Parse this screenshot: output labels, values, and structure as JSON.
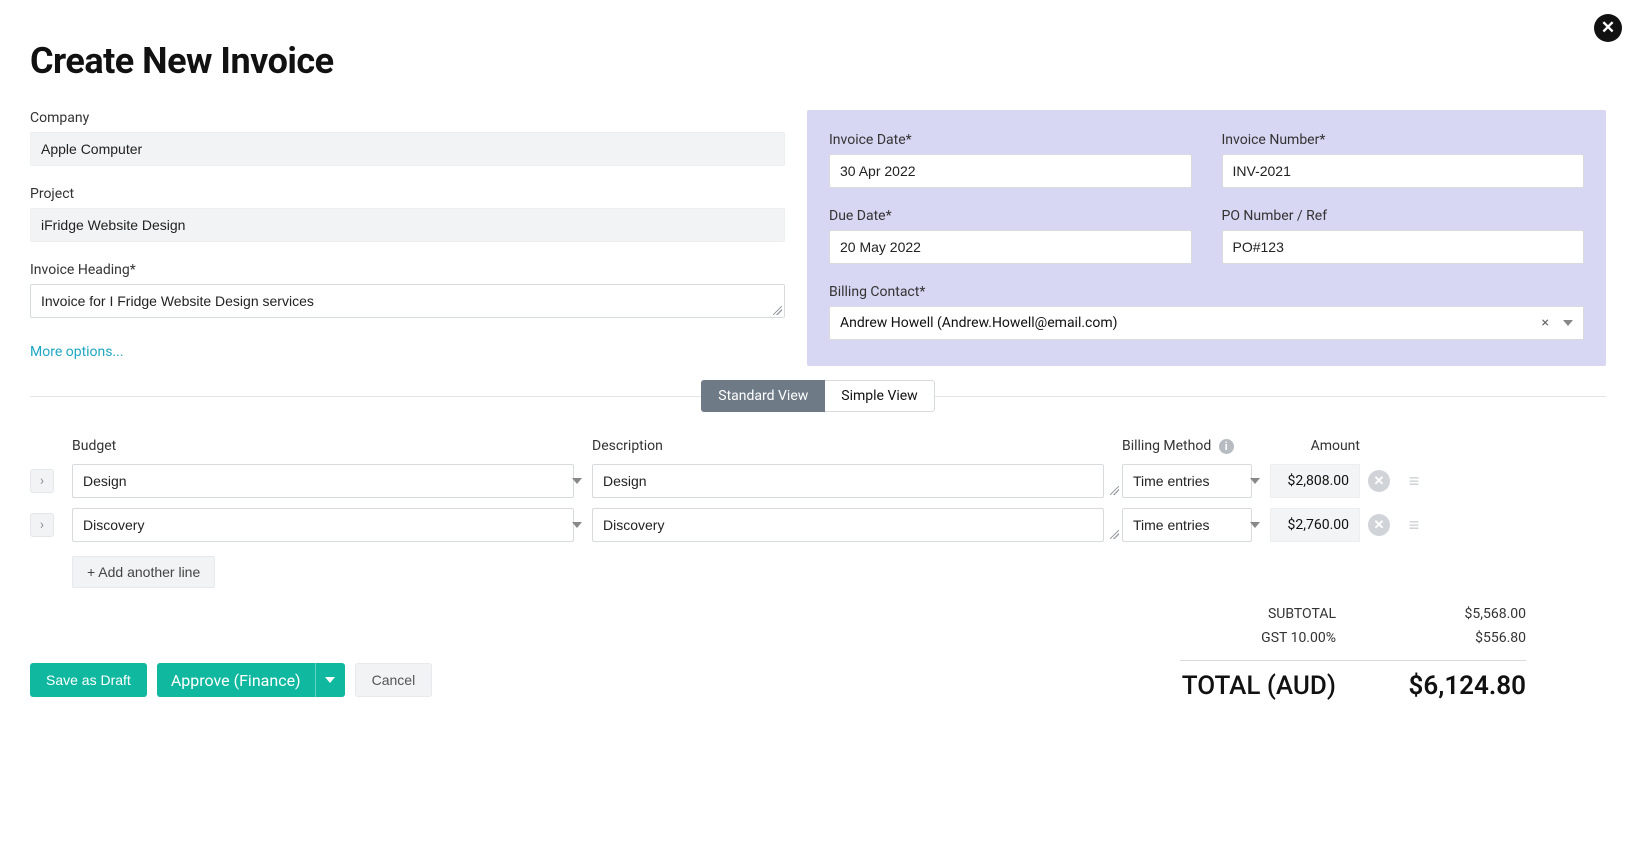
{
  "title": "Create New Invoice",
  "left": {
    "company_label": "Company",
    "company_value": "Apple Computer",
    "project_label": "Project",
    "project_value": "iFridge Website Design",
    "heading_label": "Invoice Heading*",
    "heading_value": "Invoice for I Fridge Website Design services",
    "more_options": "More options..."
  },
  "right": {
    "invoice_date_label": "Invoice Date*",
    "invoice_date_value": "30 Apr 2022",
    "invoice_number_label": "Invoice Number*",
    "invoice_number_value": "INV-2021",
    "due_date_label": "Due Date*",
    "due_date_value": "20 May 2022",
    "po_label": "PO Number / Ref",
    "po_value": "PO#123",
    "billing_label": "Billing Contact*",
    "billing_value": "Andrew Howell (Andrew.Howell@email.com)"
  },
  "tabs": {
    "standard": "Standard View",
    "simple": "Simple View"
  },
  "headers": {
    "budget": "Budget",
    "description": "Description",
    "billing_method": "Billing Method",
    "amount": "Amount"
  },
  "lines": [
    {
      "budget": "Design",
      "description": "Design",
      "method": "Time entries",
      "amount": "$2,808.00"
    },
    {
      "budget": "Discovery",
      "description": "Discovery",
      "method": "Time entries",
      "amount": "$2,760.00"
    }
  ],
  "add_line": "+ Add another line",
  "totals": {
    "subtotal_label": "SUBTOTAL",
    "subtotal_value": "$5,568.00",
    "gst_label": "GST 10.00%",
    "gst_value": "$556.80",
    "total_label": "TOTAL (AUD)",
    "total_value": "$6,124.80"
  },
  "footer": {
    "save_draft": "Save as Draft",
    "approve": "Approve (Finance)",
    "cancel": "Cancel"
  }
}
